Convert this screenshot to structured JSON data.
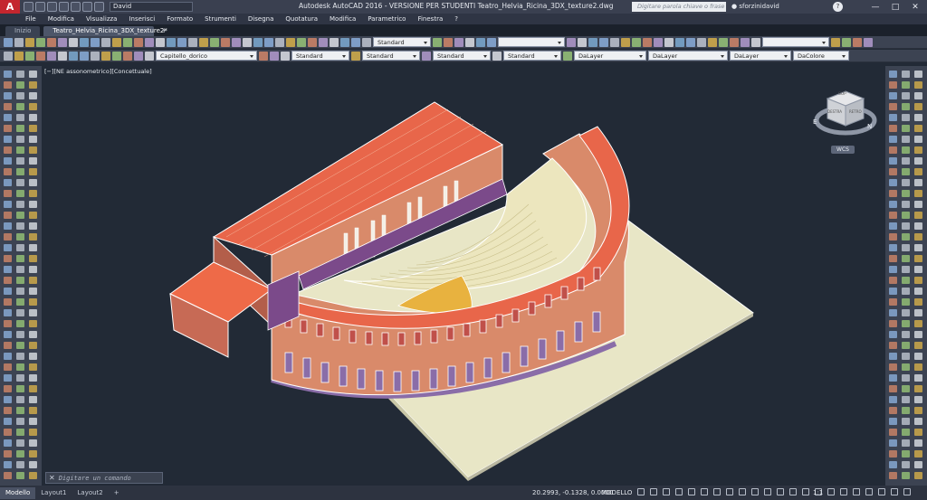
{
  "app": {
    "logo": "A",
    "workspace": "David",
    "title": "Autodesk AutoCAD 2016 - VERSIONE PER STUDENTI    Teatro_Helvia_Ricina_3DX_texture2.dwg",
    "search_placeholder": "Digitare parola chiave o frase",
    "user": "sforzinidavid",
    "help": "?"
  },
  "menu": [
    "File",
    "Modifica",
    "Visualizza",
    "Inserisci",
    "Formato",
    "Strumenti",
    "Disegna",
    "Quotatura",
    "Modifica",
    "Parametrico",
    "Finestra",
    "?"
  ],
  "file_tabs": [
    {
      "label": "Inizio"
    },
    {
      "label": "Teatro_Helvia_Ricina_3DX_texture2*"
    }
  ],
  "toolbar1": {
    "text_style": "Standard",
    "dim_style": "Standard"
  },
  "toolbar2": {
    "layer": "Capitello_dorico",
    "style1": "Standard",
    "style2": "Standard",
    "style3": "Standard",
    "style4": "Standard",
    "color": "DaLayer",
    "linetype": "DaLayer",
    "lineweight": "DaLayer",
    "plotstyle": "DaColore"
  },
  "viewport": {
    "label": "[−][NE assonometrico][Concettuale]",
    "viewcube": {
      "top": "SUP",
      "left": "DESTRA",
      "front": "RETRO",
      "compass_e": "E",
      "compass_n": "N",
      "wcs": "WCS"
    }
  },
  "command": {
    "placeholder": "Digitare un comando",
    "close": "✕"
  },
  "layout_tabs": [
    "Modello",
    "Layout1",
    "Layout2"
  ],
  "status": {
    "coords": "20.2993, -0.1328, 0.0000",
    "mode": "MODELLO",
    "scale": "1:1"
  },
  "colors": {
    "roof": "#e8664a",
    "wall_salmon": "#d98a6a",
    "purple": "#7b4a8a",
    "cavea_cream": "#ece6be",
    "ground": "#e8e6c6",
    "orchestra": "#e8b23f",
    "arch_red": "#c0504a",
    "arch_violet": "#8a6da8"
  }
}
